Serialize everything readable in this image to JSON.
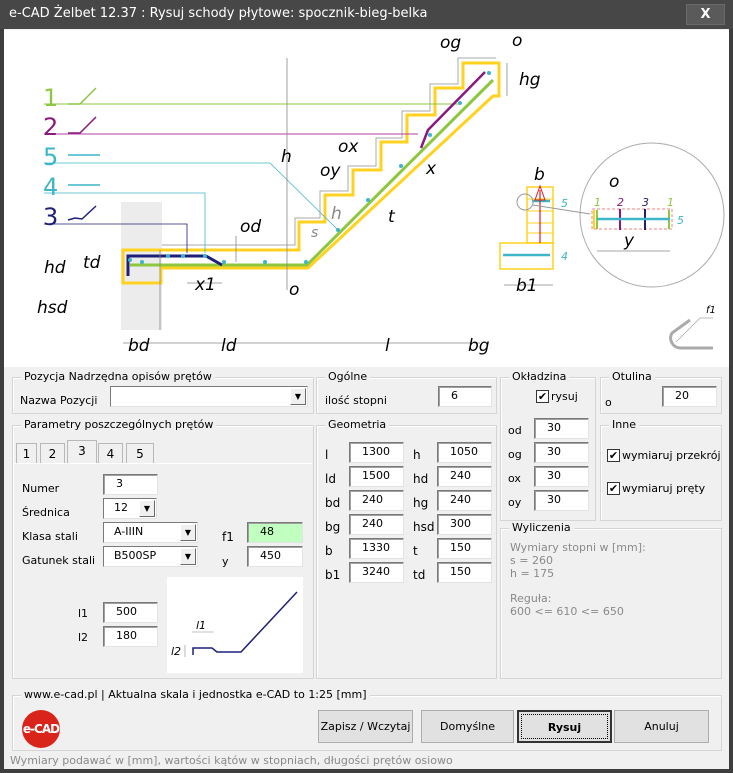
{
  "window": {
    "title": "e-CAD Żelbet 12.37 : Rysuj schody płytowe: spocznik-bieg-belka",
    "close_label": "X"
  },
  "colors": {
    "bar1": "#8dc63f",
    "bar2": "#8b1a7e",
    "bar3": "#1f1f78",
    "bar4": "#3cb6c8",
    "bar5": "#3cb6c8",
    "concrete": "#ffd21f",
    "f1_field": "#c0ffc0",
    "logo": "#d9241c"
  },
  "drawing": {
    "legend": [
      "1",
      "2",
      "5",
      "4",
      "3"
    ],
    "dims": {
      "og": "og",
      "o_top": "o",
      "hg": "hg",
      "h": "h",
      "ox": "ox",
      "oy": "oy",
      "x": "x",
      "h_step": "h",
      "s": "s",
      "t": "t",
      "od": "od",
      "td": "td",
      "hd": "hd",
      "hsd": "hsd",
      "x1": "x1",
      "o_bottom": "o",
      "bd": "bd",
      "ld": "ld",
      "l": "l",
      "bg": "bg",
      "b": "b",
      "b1": "b1",
      "sec5": "5",
      "sec4": "4",
      "det_o": "o",
      "det_1a": "1",
      "det_2": "2",
      "det_3": "3",
      "det_1b": "1",
      "det_5": "5",
      "det_y": "y",
      "f1": "f1"
    }
  },
  "pozycja": {
    "caption": "Pozycja Nadrzędna opisów prętów",
    "label": "Nazwa Pozycji",
    "value": ""
  },
  "ogolne": {
    "caption": "Ogólne",
    "label": "ilość stopni",
    "value": "6"
  },
  "okladzina": {
    "caption": "Okładzina",
    "rysuj_label": "rysuj",
    "rysuj_checked": true,
    "fields": [
      {
        "label": "od",
        "value": "30"
      },
      {
        "label": "og",
        "value": "30"
      },
      {
        "label": "ox",
        "value": "30"
      },
      {
        "label": "oy",
        "value": "30"
      }
    ]
  },
  "otulina": {
    "caption": "Otulina",
    "label": "o",
    "value": "20"
  },
  "inne": {
    "caption": "Inne",
    "przekroj_label": "wymiaruj przekrój",
    "przekroj_checked": true,
    "prety_label": "wymiaruj pręty",
    "prety_checked": true
  },
  "wyliczenia": {
    "caption": "Wyliczenia",
    "lines": [
      "Wymiary stopni w [mm]:",
      "s = 260",
      "h = 175",
      "",
      "Reguła:",
      "600 <= 610 <= 650"
    ]
  },
  "parametry": {
    "caption": "Parametry poszczególnych prętów",
    "tabs": [
      "1",
      "2",
      "3",
      "4",
      "5"
    ],
    "active_tab": "3",
    "numer_label": "Numer",
    "numer": "3",
    "srednica_label": "Średnica",
    "srednica": "12",
    "klasa_label": "Klasa stali",
    "klasa": "A-IIIN",
    "gatunek_label": "Gatunek stali",
    "gatunek": "B500SP",
    "f1_label": "f1",
    "f1": "48",
    "y_label": "y",
    "y": "450",
    "l1_label": "l1",
    "l1": "500",
    "l2_label": "l2",
    "l2": "180",
    "preview": {
      "l1": "l1",
      "l2": "l2"
    }
  },
  "geometria": {
    "caption": "Geometria",
    "left": [
      {
        "label": "l",
        "value": "1300"
      },
      {
        "label": "ld",
        "value": "1500"
      },
      {
        "label": "bd",
        "value": "240"
      },
      {
        "label": "bg",
        "value": "240"
      },
      {
        "label": "b",
        "value": "1330"
      },
      {
        "label": "b1",
        "value": "3240"
      }
    ],
    "right": [
      {
        "label": "h",
        "value": "1050"
      },
      {
        "label": "hd",
        "value": "240"
      },
      {
        "label": "hg",
        "value": "240"
      },
      {
        "label": "hsd",
        "value": "300"
      },
      {
        "label": "t",
        "value": "150"
      },
      {
        "label": "td",
        "value": "150"
      }
    ]
  },
  "footer": {
    "caption": "www.e-cad.pl | Aktualna skala i jednostka e-CAD to 1:25 [mm]",
    "logo_text": "e-CAD",
    "buttons": {
      "save": "Zapisz / Wczytaj",
      "defaults": "Domyślne",
      "draw": "Rysuj",
      "cancel": "Anuluj"
    },
    "status": "Wymiary podawać w [mm], wartości kątów w stopniach, długości prętów osiowo"
  }
}
